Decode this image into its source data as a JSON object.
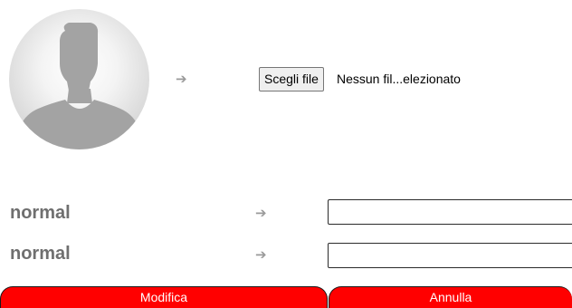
{
  "profile": {
    "avatar_icon": "default-user-silhouette-icon",
    "arrow_icon": "arrow-right-icon",
    "file_picker": {
      "button_label": "Scegli file",
      "status_text": "Nessun fil...elezionato"
    }
  },
  "fields": [
    {
      "label": "normal",
      "arrow_icon": "arrow-right-icon",
      "value": ""
    },
    {
      "label": "normal",
      "arrow_icon": "arrow-right-icon",
      "value": ""
    }
  ],
  "actions": {
    "modify_label": "Modifica",
    "cancel_label": "Annulla",
    "button_color": "#ff0000",
    "button_text_color": "#ffffff"
  },
  "colors": {
    "label_gray": "#6f6f6f",
    "arrow_gray": "#9a9a9a",
    "silhouette_gray": "#a3a3a3"
  }
}
